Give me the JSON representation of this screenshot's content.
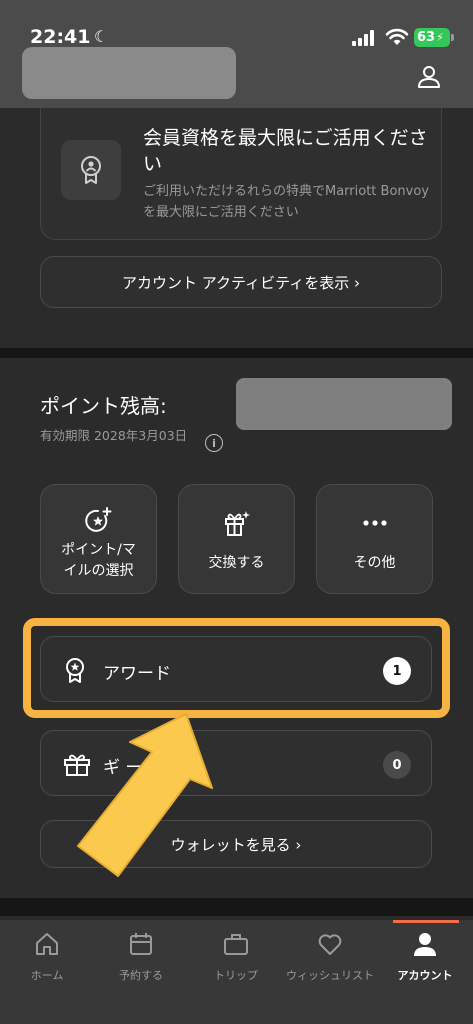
{
  "status_bar": {
    "time": "22:41",
    "battery": "63"
  },
  "header": {
    "user_icon": "person-icon"
  },
  "member_card": {
    "title": "会員資格を最大限にご活用ください",
    "description": "ご利用いただけるれらの特典でMarriott Bonvoyを最大限にご活用ください",
    "icon": "medal-icon"
  },
  "activity_button": {
    "label": "アカウント アクティビティを表示 ›"
  },
  "points": {
    "label": "ポイント残高:",
    "expiry": "有効期限 2028年3月03日"
  },
  "tiles": [
    {
      "label": "ポイント/マイルの選択",
      "icon": "star-plus-icon"
    },
    {
      "label": "交換する",
      "icon": "gift-sparkle-icon"
    },
    {
      "label": "その他",
      "icon": "more-dots-icon"
    }
  ],
  "award_row": {
    "label": "アワード",
    "count": "1",
    "icon": "award-ribbon-icon"
  },
  "gift_row": {
    "label": "ギ ード",
    "count": "0",
    "icon": "gift-box-icon"
  },
  "wallet_button": {
    "label": "ウォレットを見る ›"
  },
  "tabbar": {
    "items": [
      {
        "label": "ホーム",
        "icon": "home-icon"
      },
      {
        "label": "予約する",
        "icon": "calendar-icon"
      },
      {
        "label": "トリップ",
        "icon": "briefcase-icon"
      },
      {
        "label": "ウィッシュリスト",
        "icon": "heart-icon"
      },
      {
        "label": "アカウント",
        "icon": "account-icon"
      }
    ],
    "active_index": 4
  },
  "colors": {
    "highlight": "#f7b342",
    "arrow": "#fbc94d",
    "accent": "#f36d4a"
  }
}
